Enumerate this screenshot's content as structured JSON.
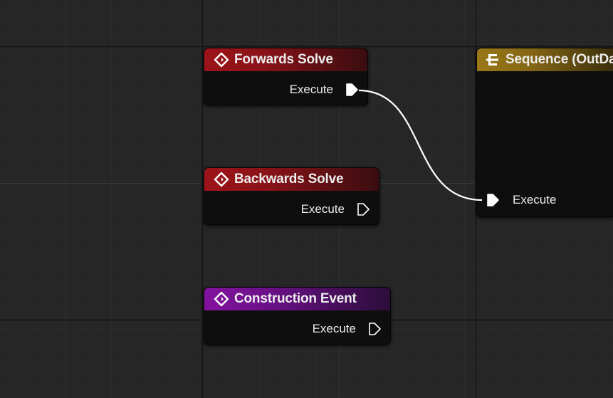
{
  "colors": {
    "background": "#262626",
    "grid_minor": "#2f2f2f",
    "grid_major": "#161616",
    "event_header": "#9c1419",
    "construction_header": "#83129e",
    "sequence_header": "#9a7818",
    "wire": "#ffffff"
  },
  "icons": {
    "event": "event-diamond-icon",
    "sequence": "sequence-icon",
    "exec_pin_connected": "exec-pin-filled-icon",
    "exec_pin_unconnected": "exec-pin-outline-icon"
  },
  "nodes": {
    "forwards_solve": {
      "title": "Forwards Solve",
      "pin_label": "Execute",
      "pin_connected": true
    },
    "backwards_solve": {
      "title": "Backwards Solve",
      "pin_label": "Execute",
      "pin_connected": false
    },
    "construction_event": {
      "title": "Construction Event",
      "pin_label": "Execute",
      "pin_connected": false
    },
    "sequence": {
      "title": "Sequence (OutData)",
      "pin_label": "Execute",
      "pin_connected": true
    }
  }
}
